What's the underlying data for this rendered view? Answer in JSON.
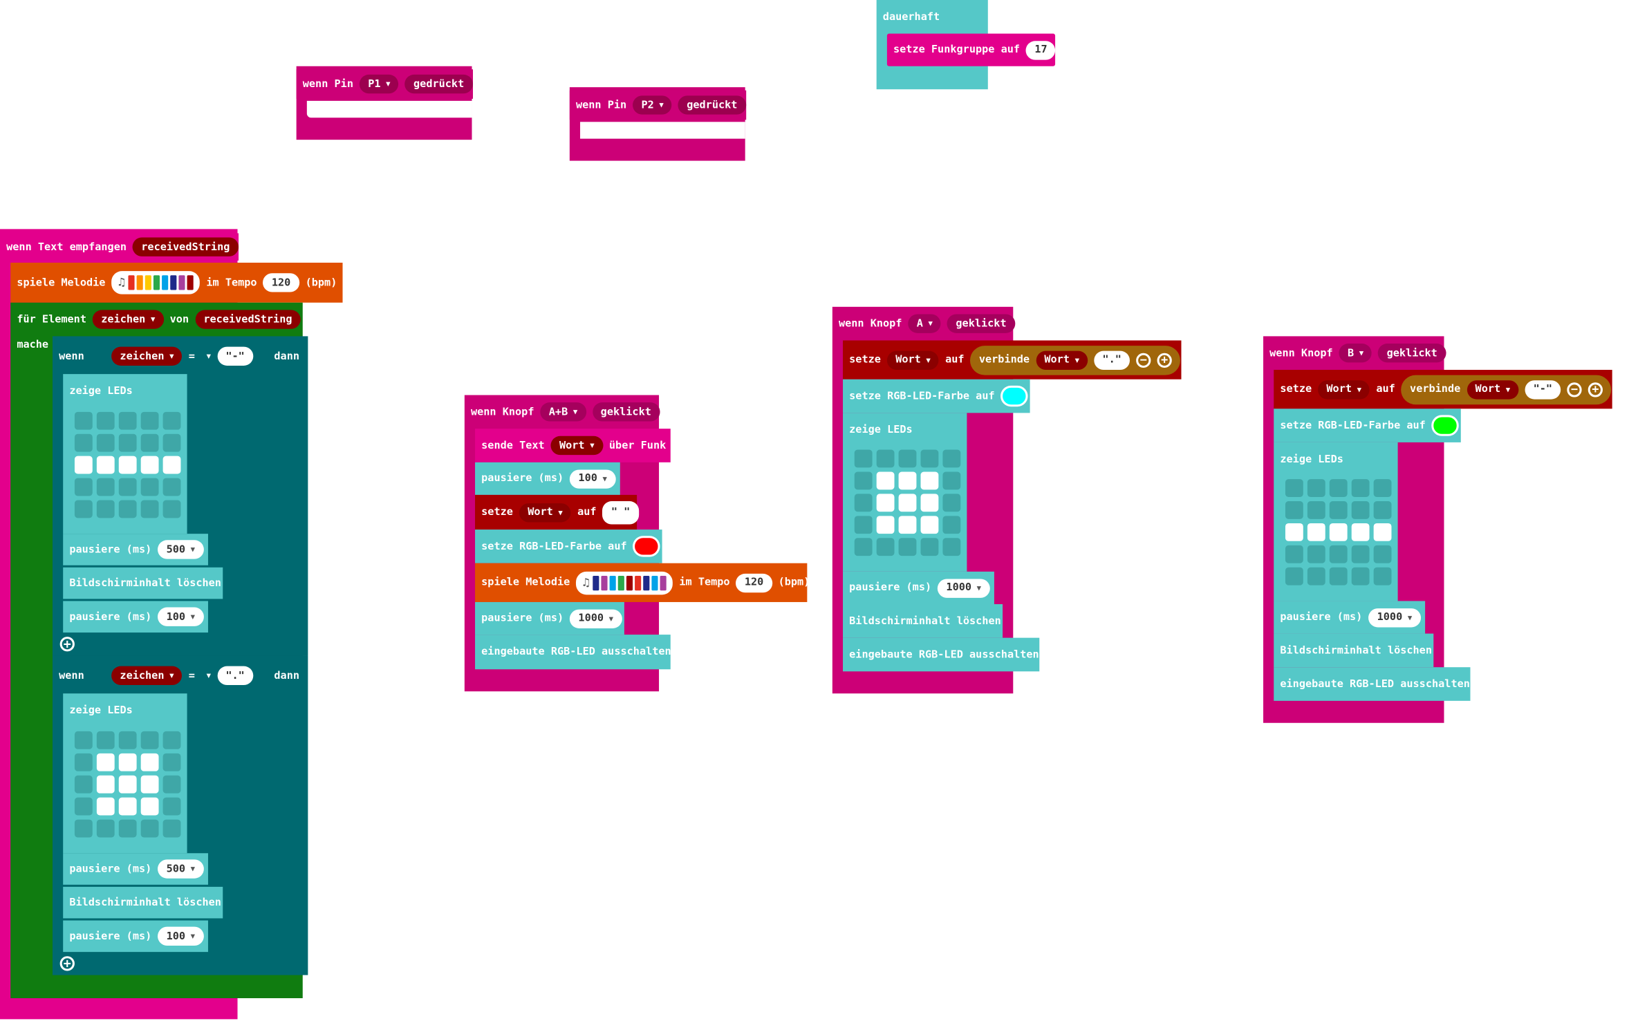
{
  "events": {
    "forever": {
      "label": "dauerhaft",
      "set_group": "setze Funkgruppe auf",
      "group_value": "17"
    },
    "pin1": {
      "label_when": "wenn Pin",
      "pin": "P1",
      "pressed": "gedrückt"
    },
    "pin2": {
      "label_when": "wenn Pin",
      "pin": "P2",
      "pressed": "gedrückt"
    },
    "received": {
      "label": "wenn Text empfangen",
      "var": "receivedString"
    }
  },
  "melody_block": {
    "label": "spiele Melodie",
    "tempo_label": "im Tempo",
    "tempo": "120",
    "unit": "(bpm)"
  },
  "foreach": {
    "label": "für Element",
    "var": "zeichen",
    "of": "von",
    "list": "receivedString",
    "do": "mache"
  },
  "if_dash": {
    "wenn": "wenn",
    "var": "zeichen",
    "op": "=",
    "value": "\"-\"",
    "dann": "dann"
  },
  "if_dot": {
    "wenn": "wenn",
    "var": "zeichen",
    "op": "=",
    "value": "\".\"",
    "dann": "dann"
  },
  "common": {
    "show_leds": "zeige LEDs",
    "pause": "pausiere (ms)",
    "clear": "Bildschirminhalt löschen",
    "led_off": "eingebaute RGB-LED ausschalten",
    "set_rgb": "setze RGB-LED-Farbe auf",
    "p500": "500",
    "p100": "100",
    "p1000": "1000"
  },
  "btn_ab": {
    "when": "wenn Knopf",
    "btn": "A+B",
    "clicked": "geklickt",
    "send": "sende Text",
    "var": "Wort",
    "via": "über Funk",
    "set": "setze",
    "to": "auf",
    "empty": "\" \""
  },
  "btn_a": {
    "when": "wenn Knopf",
    "btn": "A",
    "clicked": "geklickt",
    "set": "setze",
    "var": "Wort",
    "to": "auf",
    "join": "verbinde",
    "join_var": "Wort",
    "join_val": "\".\""
  },
  "btn_b": {
    "when": "wenn Knopf",
    "btn": "B",
    "clicked": "geklickt",
    "set": "setze",
    "var": "Wort",
    "to": "auf",
    "join": "verbinde",
    "join_var": "Wort",
    "join_val": "\"-\""
  },
  "colors": {
    "cyan": "#00ffff",
    "red": "#ff0000",
    "green": "#00ff00"
  },
  "led_patterns": {
    "dash": [
      [
        0,
        0,
        0,
        0,
        0
      ],
      [
        0,
        0,
        0,
        0,
        0
      ],
      [
        1,
        1,
        1,
        1,
        1
      ],
      [
        0,
        0,
        0,
        0,
        0
      ],
      [
        0,
        0,
        0,
        0,
        0
      ]
    ],
    "dot": [
      [
        0,
        0,
        0,
        0,
        0
      ],
      [
        0,
        1,
        1,
        1,
        0
      ],
      [
        0,
        1,
        1,
        1,
        0
      ],
      [
        0,
        1,
        1,
        1,
        0
      ],
      [
        0,
        0,
        0,
        0,
        0
      ]
    ],
    "a": [
      [
        0,
        0,
        0,
        0,
        0
      ],
      [
        0,
        1,
        1,
        1,
        0
      ],
      [
        0,
        1,
        1,
        1,
        0
      ],
      [
        0,
        1,
        1,
        1,
        0
      ],
      [
        0,
        0,
        0,
        0,
        0
      ]
    ],
    "b": [
      [
        0,
        0,
        0,
        0,
        0
      ],
      [
        0,
        0,
        0,
        0,
        0
      ],
      [
        1,
        1,
        1,
        1,
        1
      ],
      [
        0,
        0,
        0,
        0,
        0
      ],
      [
        0,
        0,
        0,
        0,
        0
      ]
    ]
  }
}
